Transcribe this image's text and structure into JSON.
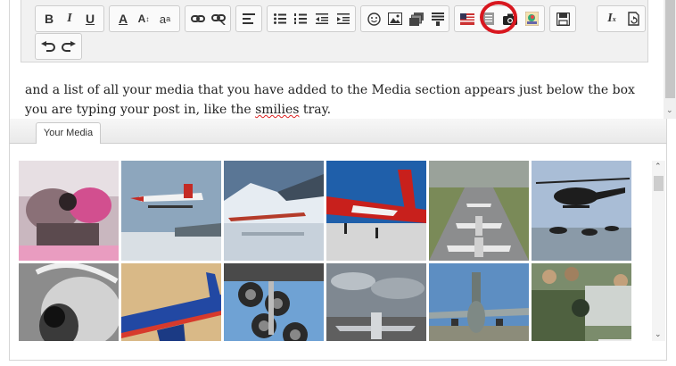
{
  "toolbar": {
    "rows": [
      [
        "bold",
        "italic",
        "underline",
        "text-color",
        "font-size",
        "font-family",
        "link",
        "unlink",
        "align",
        "bullet-list",
        "numbered-list",
        "outdent",
        "indent",
        "smilies",
        "insert-image",
        "media",
        "quote",
        "code",
        "insert-html",
        "camera",
        "gallery",
        "save",
        "remove-format",
        "restore"
      ],
      [
        "undo",
        "redo"
      ]
    ]
  },
  "editor": {
    "text_before": "and a list of all your media that you have added to the Media section appears just below the box you are typing your post in, like the ",
    "spell_word": "smilies",
    "text_after": " tray."
  },
  "media_tab": {
    "label": "Your Media"
  },
  "media": {
    "thumbnails": [
      "robot-cockpit",
      "seaplane-takeoff",
      "antarctic-jet",
      "red-jetliner",
      "airfield-jets",
      "black-helicopters",
      "pilot-cockpit-bw",
      "blue-airliner",
      "landing-gear",
      "military-jet-ground",
      "cargo-plane",
      "soldiers-vehicle"
    ]
  }
}
